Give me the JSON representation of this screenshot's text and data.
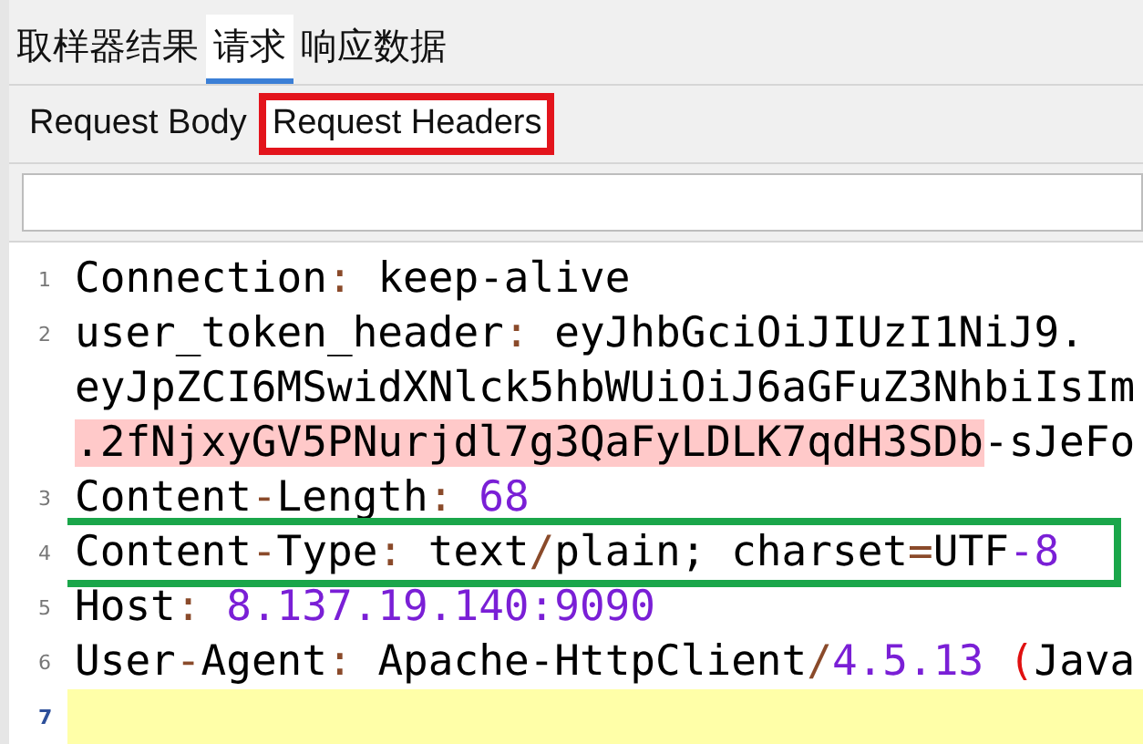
{
  "tabs": [
    {
      "label": "取样器结果",
      "selected": false
    },
    {
      "label": "请求",
      "selected": true
    },
    {
      "label": "响应数据",
      "selected": false
    }
  ],
  "subtabs": [
    {
      "label": "Request Body",
      "selected": false,
      "boxed": false
    },
    {
      "label": "Request Headers",
      "selected": true,
      "boxed": true
    }
  ],
  "editor": {
    "lines": [
      {
        "number": "1",
        "current": false,
        "boxed": false,
        "rows": [
          {
            "segments": [
              {
                "text": "Connection",
                "kind": "plain"
              },
              {
                "text": ":",
                "kind": "punct"
              },
              {
                "text": " keep-alive",
                "kind": "plain"
              }
            ]
          }
        ]
      },
      {
        "number": "2",
        "current": false,
        "boxed": false,
        "rows": [
          {
            "segments": [
              {
                "text": "user_token_header",
                "kind": "plain"
              },
              {
                "text": ":",
                "kind": "punct"
              },
              {
                "text": " eyJhbGciOiJIUzI1NiJ9.",
                "kind": "plain"
              }
            ]
          },
          {
            "segments": [
              {
                "text": "eyJpZCI6MSwidXNlck5hbWUiOiJ6aGFuZ3NhbiIsIm",
                "kind": "plain"
              }
            ]
          },
          {
            "segments": [
              {
                "text": ".2fNjxyGV5PNurjdl7g3QaFyLDLK7qdH3SDb",
                "kind": "marked"
              },
              {
                "text": "-sJeFo",
                "kind": "plain"
              }
            ]
          }
        ]
      },
      {
        "number": "3",
        "current": false,
        "boxed": false,
        "rows": [
          {
            "segments": [
              {
                "text": "Content",
                "kind": "plain"
              },
              {
                "text": "-",
                "kind": "punct"
              },
              {
                "text": "Length",
                "kind": "plain"
              },
              {
                "text": ":",
                "kind": "punct"
              },
              {
                "text": " 68",
                "kind": "number"
              }
            ]
          }
        ]
      },
      {
        "number": "4",
        "current": false,
        "boxed": true,
        "rows": [
          {
            "segments": [
              {
                "text": "Content",
                "kind": "plain"
              },
              {
                "text": "-",
                "kind": "punct"
              },
              {
                "text": "Type",
                "kind": "plain"
              },
              {
                "text": ":",
                "kind": "punct"
              },
              {
                "text": " text",
                "kind": "plain"
              },
              {
                "text": "/",
                "kind": "punct"
              },
              {
                "text": "plain; charset",
                "kind": "plain"
              },
              {
                "text": "=",
                "kind": "punct"
              },
              {
                "text": "UTF",
                "kind": "plain"
              },
              {
                "text": "-8",
                "kind": "number"
              }
            ]
          }
        ]
      },
      {
        "number": "5",
        "current": false,
        "boxed": false,
        "rows": [
          {
            "segments": [
              {
                "text": "Host",
                "kind": "plain"
              },
              {
                "text": ":",
                "kind": "punct"
              },
              {
                "text": " 8.137.19.140:9090",
                "kind": "number"
              }
            ]
          }
        ]
      },
      {
        "number": "6",
        "current": false,
        "boxed": false,
        "rows": [
          {
            "segments": [
              {
                "text": "User",
                "kind": "plain"
              },
              {
                "text": "-",
                "kind": "punct"
              },
              {
                "text": "Agent",
                "kind": "plain"
              },
              {
                "text": ":",
                "kind": "punct"
              },
              {
                "text": " Apache-HttpClient",
                "kind": "plain"
              },
              {
                "text": "/",
                "kind": "punct"
              },
              {
                "text": "4.5.13",
                "kind": "number"
              },
              {
                "text": " (",
                "kind": "paren"
              },
              {
                "text": "Java",
                "kind": "plain"
              }
            ]
          }
        ]
      },
      {
        "number": "7",
        "current": true,
        "boxed": false,
        "rows": [
          {
            "segments": []
          }
        ]
      }
    ]
  }
}
